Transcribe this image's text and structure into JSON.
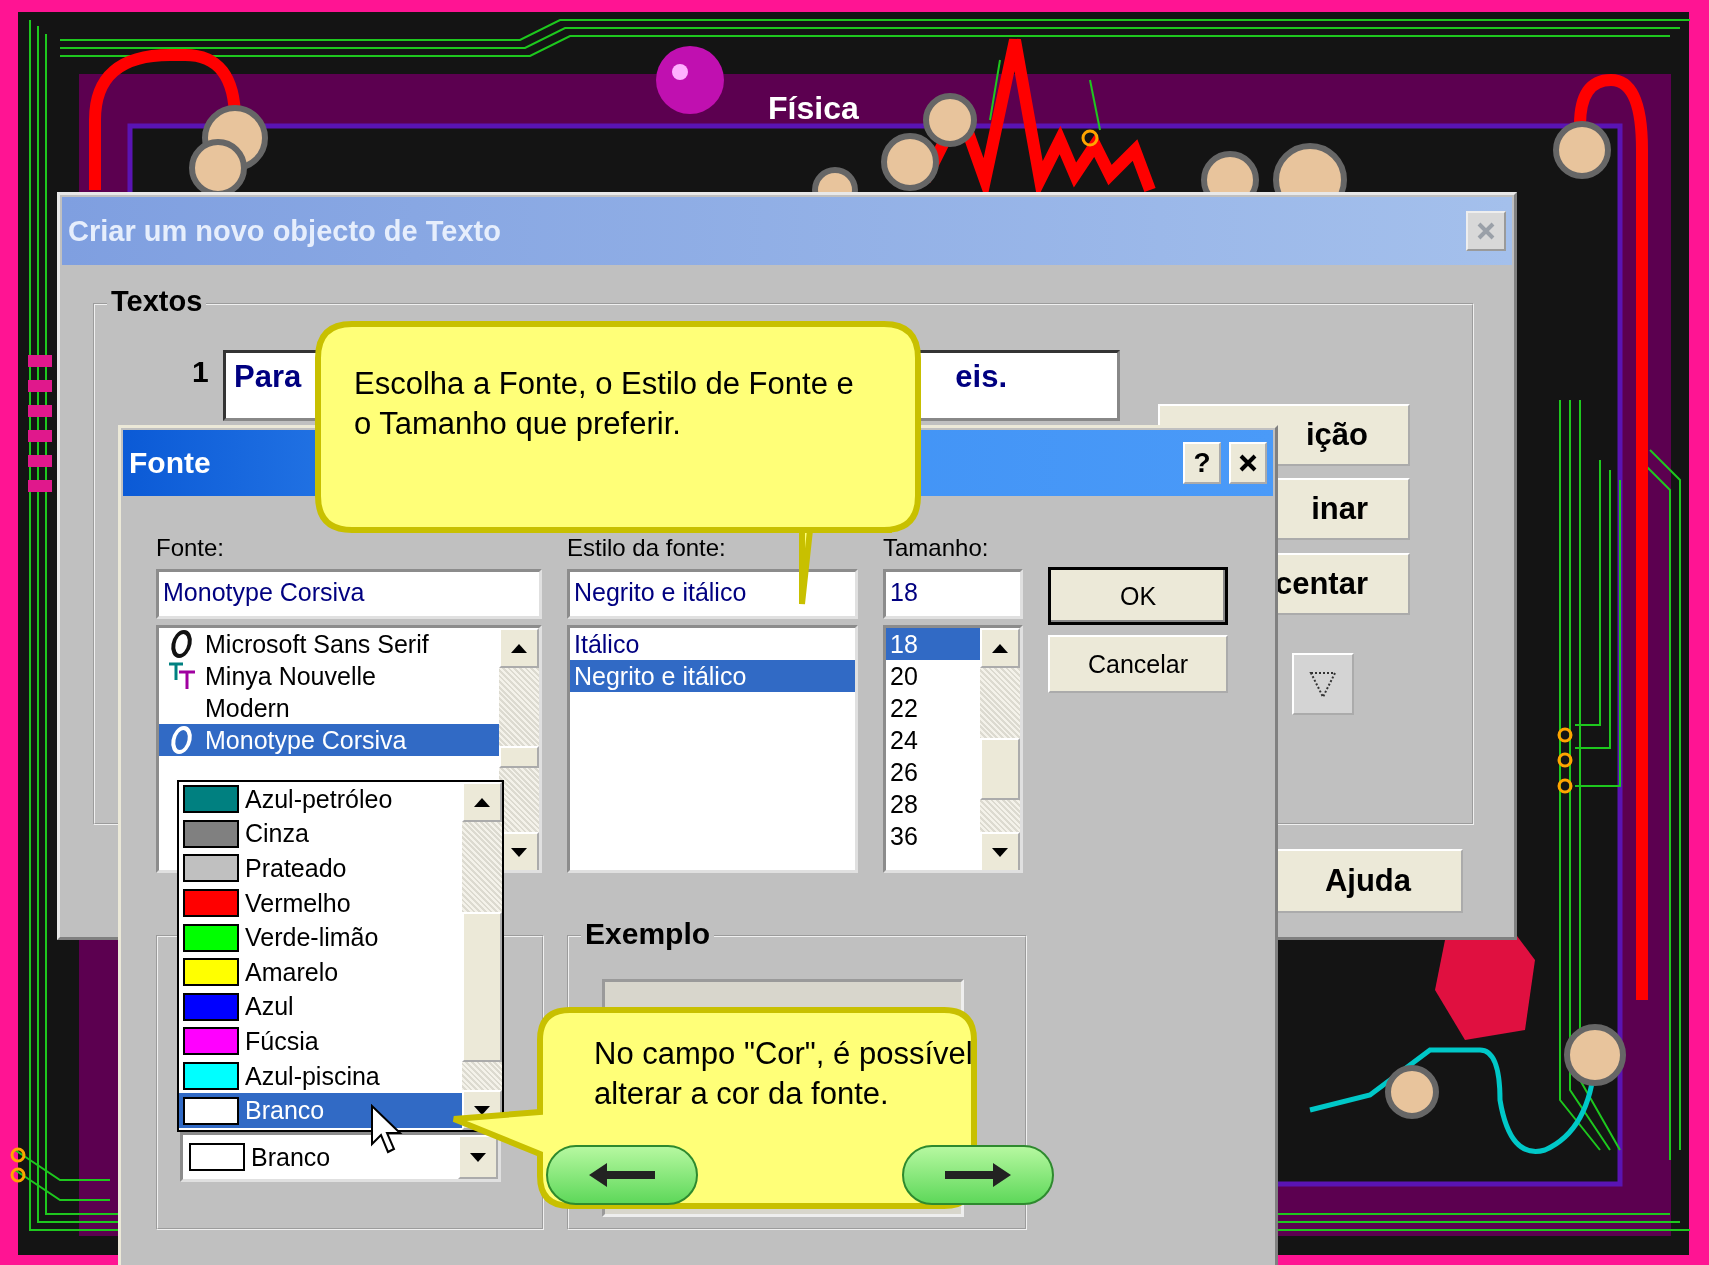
{
  "background": {
    "title": "Física"
  },
  "main_dialog": {
    "title": "Criar um novo objecto de Texto",
    "group_title": "Textos",
    "row_number": "1",
    "text_visible_start": "Para",
    "text_visible_end": "eis.",
    "side_buttons": [
      "ição",
      "inar",
      "centar"
    ],
    "help_button": "Ajuda"
  },
  "font_dialog": {
    "title": "Fonte",
    "help_button": "?",
    "font": {
      "label": "Fonte:",
      "value": "Monotype Corsiva",
      "items": [
        {
          "name": "Microsoft Sans Serif",
          "kind": "opentype",
          "selected": false
        },
        {
          "name": "Minya Nouvelle",
          "kind": "truetype",
          "selected": false
        },
        {
          "name": "Modern",
          "kind": "plain",
          "selected": false
        },
        {
          "name": "Monotype Corsiva",
          "kind": "opentype",
          "selected": true
        }
      ]
    },
    "style": {
      "label": "Estilo da fonte:",
      "value": "Negrito e itálico",
      "items": [
        {
          "name": "Itálico",
          "selected": false
        },
        {
          "name": "Negrito e itálico",
          "selected": true
        }
      ]
    },
    "size": {
      "label": "Tamanho:",
      "value": "18",
      "items": [
        {
          "name": "18",
          "selected": true
        },
        {
          "name": "20",
          "selected": false
        },
        {
          "name": "22",
          "selected": false
        },
        {
          "name": "24",
          "selected": false
        },
        {
          "name": "26",
          "selected": false
        },
        {
          "name": "28",
          "selected": false
        },
        {
          "name": "36",
          "selected": false
        }
      ]
    },
    "buttons": [
      "OK",
      "Cancelar"
    ],
    "sample": {
      "title": "Exemplo"
    },
    "color": {
      "value": "Branco",
      "options": [
        {
          "name": "Azul-petróleo",
          "color": "#008080",
          "selected": false
        },
        {
          "name": "Cinza",
          "color": "#808080",
          "selected": false
        },
        {
          "name": "Prateado",
          "color": "#c0c0c0",
          "selected": false
        },
        {
          "name": "Vermelho",
          "color": "#ff0000",
          "selected": false
        },
        {
          "name": "Verde-limão",
          "color": "#00ff00",
          "selected": false
        },
        {
          "name": "Amarelo",
          "color": "#ffff00",
          "selected": false
        },
        {
          "name": "Azul",
          "color": "#0000ff",
          "selected": false
        },
        {
          "name": "Fúcsia",
          "color": "#ff00ff",
          "selected": false
        },
        {
          "name": "Azul-piscina",
          "color": "#00ffff",
          "selected": false
        },
        {
          "name": "Branco",
          "color": "#ffffff",
          "selected": true
        }
      ]
    }
  },
  "callouts": [
    {
      "text": "Escolha a Fonte, o Estilo de Fonte e o Tamanho que preferir.",
      "kind": "down"
    },
    {
      "text": "No campo \"Cor\", é possível alterar a cor da fonte.",
      "kind": "left"
    }
  ]
}
